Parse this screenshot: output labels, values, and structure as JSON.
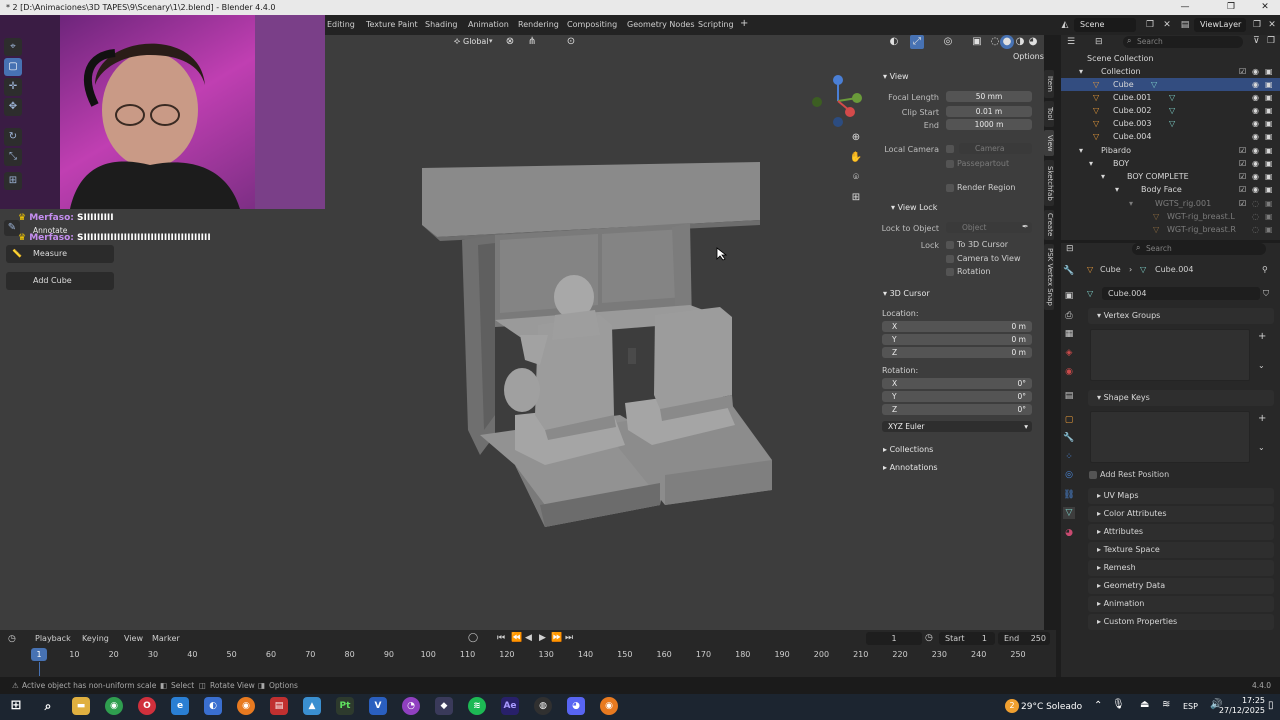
{
  "window": {
    "title": "* 2 [D:\\Animaciones\\3D TAPES\\9\\Scenary\\1\\2.blend] - Blender 4.4.0",
    "minimize": "—",
    "maximize": "❐",
    "close": "✕"
  },
  "workspace_tabs": [
    "Editing",
    "Texture Paint",
    "Shading",
    "Animation",
    "Rendering",
    "Compositing",
    "Geometry Nodes",
    "Scripting",
    "+"
  ],
  "topbar": {
    "scene_label": "Scene",
    "viewlayer_label": "ViewLayer"
  },
  "viewport_header": {
    "transform_orientation": "Global",
    "options_label": "Options"
  },
  "stream_chat": [
    {
      "user": "Merfaso:",
      "message": "SIIIIIIIII"
    },
    {
      "user": "Merfaso:",
      "message": "SIIIIIIIIIIIIIIIIIIIIIIIIIIIIIIIIIIIIII"
    }
  ],
  "toolbar": {
    "tooltip_annotate": "Annotate",
    "measure": "Measure",
    "add_cube": "Add Cube"
  },
  "npanel": {
    "view": {
      "title": "View",
      "focal_length_label": "Focal Length",
      "focal_length": "50 mm",
      "clip_start_label": "Clip Start",
      "clip_start": "0.01 m",
      "end_label": "End",
      "end": "1000 m",
      "local_camera_label": "Local Camera",
      "local_camera": "Camera",
      "passepartout": "Passepartout",
      "render_region": "Render Region"
    },
    "view_lock": {
      "title": "View Lock",
      "lock_to_object_label": "Lock to Object",
      "lock_to_object_placeholder": "Object",
      "lock_label": "Lock",
      "to_3d_cursor": "To 3D Cursor",
      "camera_to_view": "Camera to View",
      "rotation": "Rotation"
    },
    "cursor": {
      "title": "3D Cursor",
      "location_label": "Location:",
      "loc_x": "0 m",
      "loc_y": "0 m",
      "loc_z": "0 m",
      "rotation_label": "Rotation:",
      "rot_x": "0°",
      "rot_y": "0°",
      "rot_z": "0°",
      "x": "X",
      "y": "Y",
      "z": "Z",
      "mode": "XYZ Euler"
    },
    "collections": "Collections",
    "annotations": "Annotations"
  },
  "sidetabs": [
    "Item",
    "Tool",
    "View",
    "Sketchfab",
    "Create",
    "PSK Vertex Snap"
  ],
  "outliner": {
    "search_placeholder": "Search",
    "rows": [
      {
        "name": "Scene Collection",
        "indent": 0,
        "selected": false
      },
      {
        "name": "Collection",
        "indent": 1,
        "selected": false
      },
      {
        "name": "Cube",
        "indent": 2,
        "selected": true
      },
      {
        "name": "Cube.001",
        "indent": 2,
        "selected": false
      },
      {
        "name": "Cube.002",
        "indent": 2,
        "selected": false
      },
      {
        "name": "Cube.003",
        "indent": 2,
        "selected": false
      },
      {
        "name": "Cube.004",
        "indent": 2,
        "selected": false
      },
      {
        "name": "Pibardo",
        "indent": 1,
        "selected": false
      },
      {
        "name": "BOY",
        "indent": 2,
        "selected": false
      },
      {
        "name": "BOY COMPLETE",
        "indent": 3,
        "selected": false
      },
      {
        "name": "Body Face",
        "indent": 4,
        "selected": false
      },
      {
        "name": "WGTS_rig.001",
        "indent": 5,
        "selected": false
      },
      {
        "name": "WGT-rig_breast.L",
        "indent": 6,
        "selected": false
      },
      {
        "name": "WGT-rig_breast.R",
        "indent": 6,
        "selected": false
      }
    ]
  },
  "properties": {
    "search_placeholder": "Search",
    "breadcrumb_object": "Cube",
    "breadcrumb_mesh": "Cube.004",
    "mesh_name": "Cube.004",
    "sections": [
      "Vertex Groups",
      "Shape Keys",
      "Add Rest Position",
      "UV Maps",
      "Color Attributes",
      "Attributes",
      "Texture Space",
      "Remesh",
      "Geometry Data",
      "Animation",
      "Custom Properties"
    ]
  },
  "timeline": {
    "menus": [
      "Playback",
      "Keying",
      "View",
      "Marker"
    ],
    "current_frame": "1",
    "start_label": "Start",
    "start": "1",
    "end_label": "End",
    "end": "250",
    "ticks": [
      "1",
      "10",
      "20",
      "30",
      "40",
      "50",
      "60",
      "70",
      "80",
      "90",
      "100",
      "110",
      "120",
      "130",
      "140",
      "150",
      "160",
      "170",
      "180",
      "190",
      "200",
      "210",
      "220",
      "230",
      "240",
      "250"
    ]
  },
  "status": {
    "message": "Active object has non-uniform scale",
    "select": "Select",
    "rotate_view": "Rotate View",
    "options": "Options",
    "version": "4.4.0"
  },
  "taskbar": {
    "weather": "29°C Soleado",
    "weather_badge": "2",
    "language": "ESP",
    "time": "17:25",
    "date": "27/12/2025"
  },
  "colors": {
    "accent": "#4772b3",
    "viewport_bg": "#3d3d3d",
    "selection": "#334d80"
  }
}
